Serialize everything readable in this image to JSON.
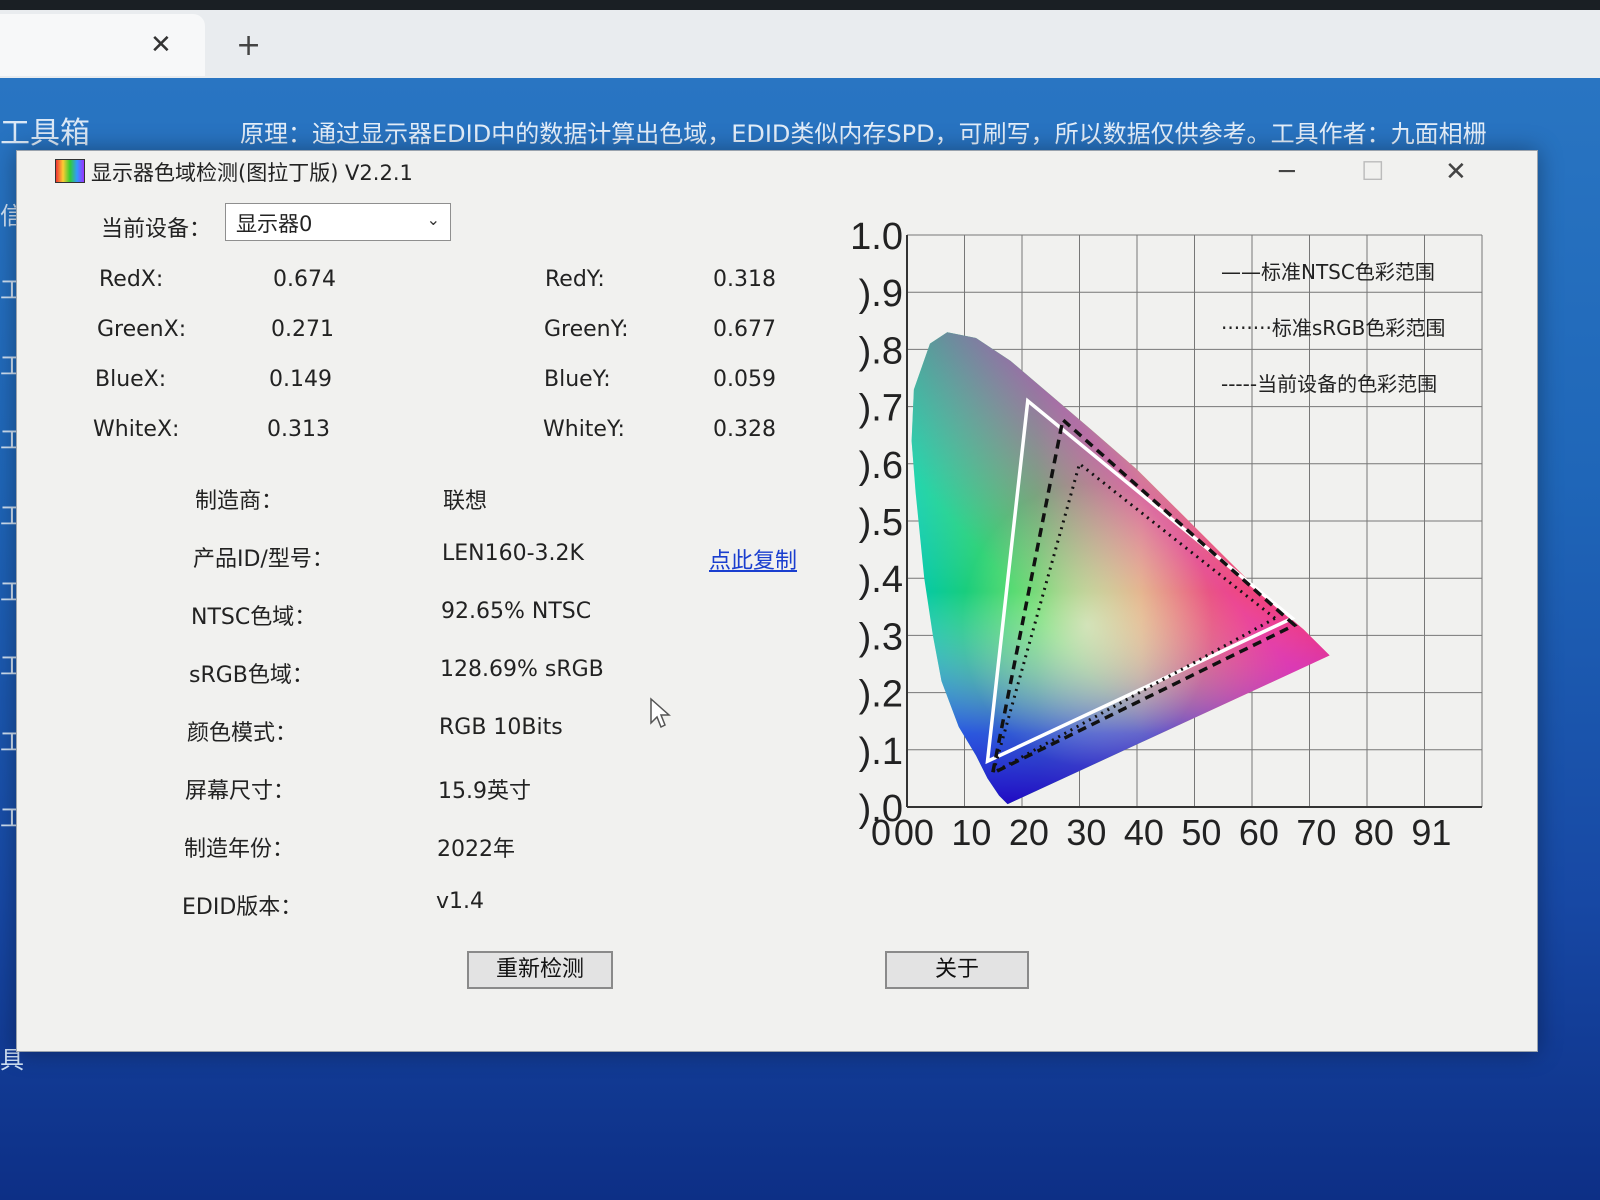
{
  "browser": {
    "tab_close": "✕",
    "new_tab": "+"
  },
  "background": {
    "title": "工具箱",
    "note": "原理：通过显示器EDID中的数据计算出色域，EDID类似内存SPD，可刷写，所以数据仅供参考。工具作者：九面相栅",
    "side_fragments": [
      "信",
      "工",
      "工",
      "工",
      "工",
      "工",
      "工",
      "工",
      "工",
      "具"
    ]
  },
  "window": {
    "title": "显示器色域检测(图拉丁版) V2.2.1",
    "minimize": "─",
    "maximize": "☐",
    "close": "✕"
  },
  "device": {
    "label": "当前设备：",
    "selected": "显示器0"
  },
  "coords": [
    {
      "label": "RedX:",
      "value": "0.674"
    },
    {
      "label": "RedY:",
      "value": "0.318"
    },
    {
      "label": "GreenX:",
      "value": "0.271"
    },
    {
      "label": "GreenY:",
      "value": "0.677"
    },
    {
      "label": "BlueX:",
      "value": "0.149"
    },
    {
      "label": "BlueY:",
      "value": "0.059"
    },
    {
      "label": "WhiteX:",
      "value": "0.313"
    },
    {
      "label": "WhiteY:",
      "value": "0.328"
    }
  ],
  "info": [
    {
      "label": "制造商：",
      "value": "联想"
    },
    {
      "label": "产品ID/型号：",
      "value": "LEN160-3.2K"
    },
    {
      "label": "NTSC色域：",
      "value": "92.65% NTSC"
    },
    {
      "label": "sRGB色域：",
      "value": "128.69% sRGB"
    },
    {
      "label": "颜色模式：",
      "value": "RGB 10Bits"
    },
    {
      "label": "屏幕尺寸：",
      "value": "15.9英寸"
    },
    {
      "label": "制造年份：",
      "value": "2022年"
    },
    {
      "label": "EDID版本：",
      "value": "v1.4"
    }
  ],
  "copy_link": "点此复制",
  "buttons": {
    "redetect": "重新检测",
    "about": "关于"
  },
  "chart_data": {
    "type": "scatter",
    "title": "",
    "x_ticks": [
      ".0",
      ".1",
      ".2",
      ".3",
      ".4",
      ".5",
      ".6",
      ".7",
      ".8",
      ".9"
    ],
    "x_tick_labels_visible": [
      "0",
      "00",
      "10",
      "20",
      "30",
      "40",
      "50",
      "60",
      "70",
      "80",
      "91"
    ],
    "y_ticks": [
      ".0",
      ".1",
      ".2",
      ".3",
      ".4",
      ".5",
      ".6",
      ".7",
      ".8",
      ".9",
      "1.0"
    ],
    "y_tick_labels_visible": [
      ").0",
      ").1",
      ").2",
      ").3",
      ").4",
      ").5",
      ").6",
      ").7",
      ").8",
      ").9",
      "1.0"
    ],
    "xlim": [
      0,
      1.0
    ],
    "ylim": [
      0,
      1.0
    ],
    "grid": true,
    "legend_position": "top-right",
    "legend": [
      {
        "style": "solid",
        "label": "——标准NTSC色彩范围"
      },
      {
        "style": "dotted",
        "label": "········标准sRGB色彩范围"
      },
      {
        "style": "dashed",
        "label": "-----当前设备的色彩范围"
      }
    ],
    "series": [
      {
        "name": "标准NTSC色彩范围",
        "style": "solid",
        "color": "#ffffff",
        "points": [
          [
            0.67,
            0.33
          ],
          [
            0.21,
            0.71
          ],
          [
            0.14,
            0.08
          ]
        ]
      },
      {
        "name": "标准sRGB色彩范围",
        "style": "dotted",
        "color": "#111111",
        "points": [
          [
            0.64,
            0.33
          ],
          [
            0.3,
            0.6
          ],
          [
            0.15,
            0.06
          ]
        ]
      },
      {
        "name": "当前设备的色彩范围",
        "style": "dashed",
        "color": "#111111",
        "points": [
          [
            0.674,
            0.318
          ],
          [
            0.271,
            0.677
          ],
          [
            0.149,
            0.059
          ]
        ]
      }
    ],
    "locus": [
      [
        0.175,
        0.005
      ],
      [
        0.17,
        0.01
      ],
      [
        0.16,
        0.02
      ],
      [
        0.14,
        0.05
      ],
      [
        0.12,
        0.09
      ],
      [
        0.09,
        0.14
      ],
      [
        0.06,
        0.22
      ],
      [
        0.045,
        0.3
      ],
      [
        0.03,
        0.4
      ],
      [
        0.015,
        0.55
      ],
      [
        0.008,
        0.64
      ],
      [
        0.012,
        0.73
      ],
      [
        0.04,
        0.81
      ],
      [
        0.07,
        0.83
      ],
      [
        0.12,
        0.82
      ],
      [
        0.18,
        0.78
      ],
      [
        0.25,
        0.72
      ],
      [
        0.32,
        0.66
      ],
      [
        0.4,
        0.59
      ],
      [
        0.47,
        0.52
      ],
      [
        0.55,
        0.44
      ],
      [
        0.62,
        0.37
      ],
      [
        0.69,
        0.31
      ],
      [
        0.735,
        0.265
      ]
    ]
  }
}
